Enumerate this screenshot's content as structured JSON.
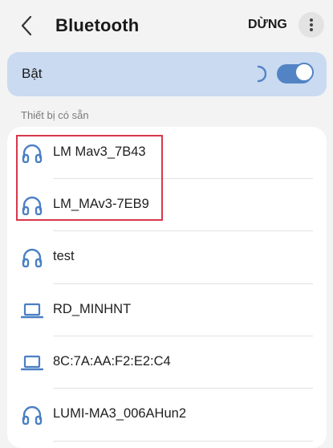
{
  "header": {
    "title": "Bluetooth",
    "stop_label": "DỪNG"
  },
  "toggle": {
    "label": "Bật",
    "state": "on"
  },
  "available": {
    "section_title": "Thiết bị có sẵn",
    "devices": [
      {
        "name": "LM Mav3_7B43",
        "icon": "headphones-icon"
      },
      {
        "name": "LM_MAv3-7EB9",
        "icon": "headphones-icon"
      },
      {
        "name": "test",
        "icon": "headphones-icon"
      },
      {
        "name": "RD_MINHNT",
        "icon": "laptop-icon"
      },
      {
        "name": "8C:7A:AA:F2:E2:C4",
        "icon": "laptop-icon"
      },
      {
        "name": "LUMI-MA3_006AHun2",
        "icon": "headphones-icon"
      }
    ]
  },
  "colors": {
    "accent": "#5284c5",
    "toggle_bar_bg": "#c9daf1",
    "highlight": "#d7374b"
  }
}
